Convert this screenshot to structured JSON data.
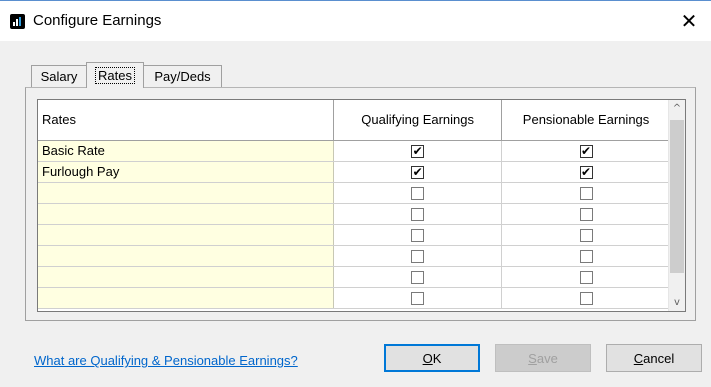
{
  "window": {
    "title": "Configure Earnings",
    "close_glyph": "✕"
  },
  "tabs": [
    {
      "label": "Salary",
      "active": false
    },
    {
      "label": "Rates",
      "active": true
    },
    {
      "label": "Pay/Deds",
      "active": false
    }
  ],
  "grid": {
    "columns": [
      "Rates",
      "Qualifying Earnings",
      "Pensionable Earnings"
    ],
    "rows": [
      {
        "rate": "Basic Rate",
        "qualifying": true,
        "pensionable": true
      },
      {
        "rate": "Furlough Pay",
        "qualifying": true,
        "pensionable": true
      },
      {
        "rate": "",
        "qualifying": false,
        "pensionable": false
      },
      {
        "rate": "",
        "qualifying": false,
        "pensionable": false
      },
      {
        "rate": "",
        "qualifying": false,
        "pensionable": false
      },
      {
        "rate": "",
        "qualifying": false,
        "pensionable": false
      },
      {
        "rate": "",
        "qualifying": false,
        "pensionable": false
      },
      {
        "rate": "",
        "qualifying": false,
        "pensionable": false
      }
    ],
    "check_glyph": "✔",
    "scroll_up_glyph": "^",
    "scroll_down_glyph": "v"
  },
  "help_link": "What are Qualifying & Pensionable Earnings?",
  "buttons": {
    "ok": {
      "mnemonic": "O",
      "rest": "K"
    },
    "save": {
      "mnemonic": "S",
      "rest": "ave",
      "enabled": false
    },
    "cancel": {
      "mnemonic": "C",
      "rest": "ancel"
    }
  },
  "colors": {
    "rate_cell_bg": "#ffffe1",
    "link": "#0066cc",
    "default_button_border": "#0078d7"
  },
  "icons": {
    "app": "app-chart-icon",
    "close": "close-icon"
  }
}
